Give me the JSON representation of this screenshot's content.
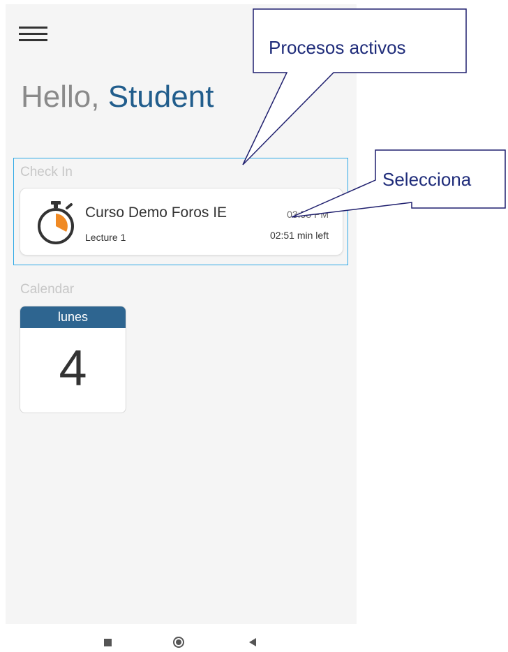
{
  "header": {
    "greeting_prefix": "Hello,",
    "greeting_name": "Student"
  },
  "checkin": {
    "section_label": "Check In",
    "course_title": "Curso Demo Foros IE",
    "lecture": "Lecture 1",
    "time": "03:58 PM",
    "time_left": "02:51 min left"
  },
  "calendar": {
    "section_label": "Calendar",
    "weekday": "lunes",
    "day": "4"
  },
  "annotations": {
    "callout_1": "Procesos activos",
    "callout_2": "Selecciona"
  },
  "colors": {
    "accent_blue": "#215d8c",
    "calendar_header": "#2e6590",
    "highlight_border": "#2da8e6",
    "callout_border": "#1f1f6e",
    "timer_orange": "#f08a24"
  },
  "icons": {
    "menu": "hamburger-icon",
    "timer": "stopwatch-icon",
    "nav_recent": "square-icon",
    "nav_home": "circle-icon",
    "nav_back": "triangle-back-icon"
  }
}
